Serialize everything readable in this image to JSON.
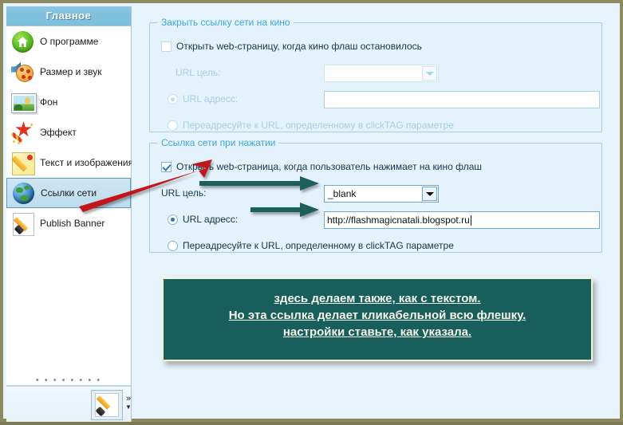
{
  "sidebar": {
    "header": "Главное",
    "items": [
      {
        "label": "О программе",
        "icon": "home-icon",
        "selected": false
      },
      {
        "label": "Размер и звук",
        "icon": "pizza-speaker-icon",
        "selected": false
      },
      {
        "label": "Фон",
        "icon": "photo-icon",
        "selected": false
      },
      {
        "label": "Эффект",
        "icon": "magic-wand-star-icon",
        "selected": false
      },
      {
        "label": "Текст и изображения",
        "icon": "pencil-note-icon",
        "selected": false
      },
      {
        "label": "Ссылки сети",
        "icon": "globe-icon",
        "selected": true
      },
      {
        "label": "Publish Banner",
        "icon": "brush-page-icon",
        "selected": false
      }
    ],
    "dots": "• • • • • • • •",
    "footer": {
      "button_icon": "brush-page-icon",
      "chevron": "»",
      "chevron_down": "▼"
    }
  },
  "panels": {
    "close_link": {
      "title": "Закрыть ссылку сети на кино",
      "checkbox_label": "Открыть web-страницу, когда кино флаш остановилось",
      "checkbox_checked": false,
      "url_target_label": "URL цель:",
      "url_target_value": "",
      "url_address_label": "URL адресс:",
      "url_address_value": "",
      "url_address_selected": true,
      "clicktag_label": "Переадресуйте к URL, определенному в clickTAG параметре",
      "clicktag_selected": false,
      "enabled": false
    },
    "click_link": {
      "title": "Ссылка сети при нажатии",
      "checkbox_label": "Открыть web-страница, когда пользователь нажимает на кино флаш",
      "checkbox_checked": true,
      "url_target_label": "URL цель:",
      "url_target_value": "_blank",
      "url_address_label": "URL адресс:",
      "url_address_value": "http://flashmagicnatali.blogspot.ru",
      "url_address_selected": true,
      "clicktag_label": "Переадресуйте к URL, определенному в clickTAG параметре",
      "clicktag_selected": false,
      "enabled": true
    }
  },
  "note": {
    "line1": "здесь делаем также, как с текстом.",
    "line2": "Но эта ссылка делает кликабельной всю флешку.",
    "line3": "настройки ставьте, как указала."
  },
  "colors": {
    "accent": "#3aa7dd",
    "sidebar_header": "#7fc0dd",
    "note_bg": "#175e5c",
    "note_border": "#f4f3d6",
    "red_arrow": "#c0171b",
    "teal_arrow": "#1b5e5c",
    "window_border": "#8c8a5e"
  }
}
